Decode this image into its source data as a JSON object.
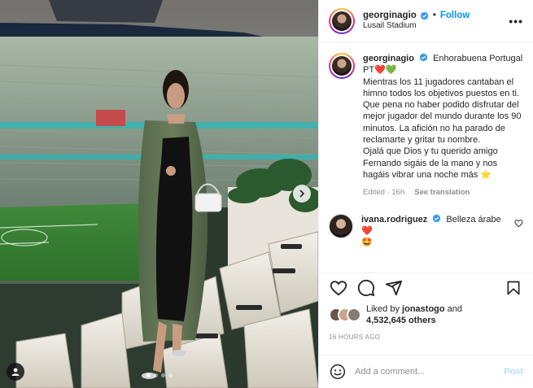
{
  "post": {
    "username": "georginagio",
    "follow_label": "Follow",
    "separator": "•",
    "location": "Lusail Stadium",
    "more_label": "•••",
    "caption": {
      "lines": [
        "Enhorabuena Portugal",
        "PT❤️💚",
        "Mientras los 11 jugadores cantaban el himno todos los objetivos puestos en ti.",
        "Que pena no haber podido disfrutar del mejor jugador del mundo durante los 90 minutos. La afición no ha parado de reclamarte y gritar tu nombre.",
        "Ojalá que Dios y tu querido amigo Fernando sigáis de la mano y nos hagáis vibrar una noche más ⭐"
      ]
    },
    "edited_label": "Edited · 16h",
    "see_translation": "See translation",
    "comment": {
      "username": "ivana.rodriguez",
      "text": "Belleza árabe ❤️",
      "emoji_line": "🤩"
    },
    "likes": {
      "prefix": "Liked by",
      "by": "jonastogo",
      "connector": "and",
      "count": "4,532,645 others"
    },
    "timestamp": "16 HOURS AGO",
    "add_comment_placeholder": "Add a comment...",
    "post_label": "Post",
    "carousel": {
      "slides": 4,
      "active": 1
    }
  },
  "colors": {
    "accent": "#0095f6",
    "post_disabled": "#b2dffc",
    "meta": "#8e8e8e",
    "verified": "#3897f0",
    "heart": "#ed4956"
  },
  "icons": [
    "verified-badge-icon",
    "more-options-icon",
    "heart-icon",
    "comment-icon",
    "share-icon",
    "bookmark-icon",
    "emoji-icon",
    "next-arrow-icon",
    "user-tag-icon"
  ]
}
